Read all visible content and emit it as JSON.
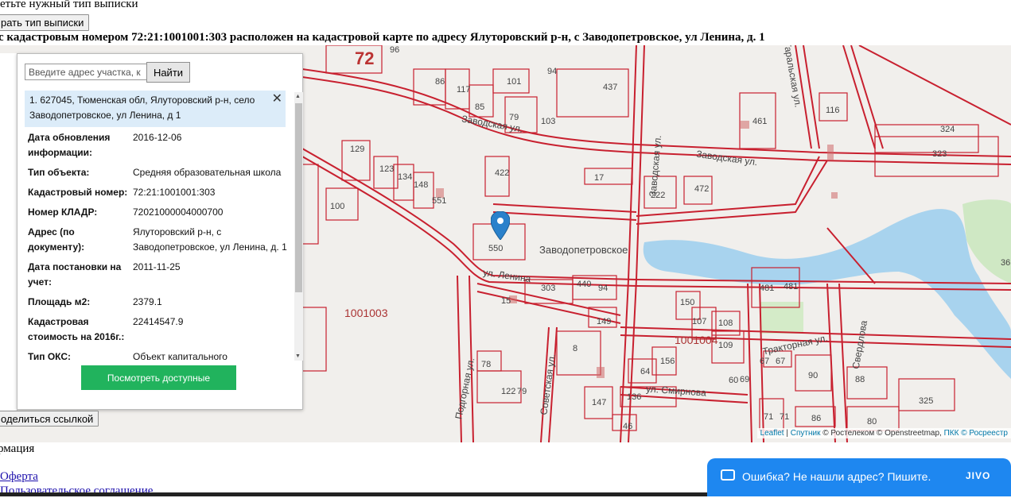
{
  "top": {
    "select_text": "етьте нужный тип выписки",
    "type_button": "рать тип выписки",
    "heading": "с кадастровым номером 72:21:1001001:303 расположен на кадастровой карте по адресу Ялуторовский р-н, с Заводопетровское, ул Ленина, д. 1"
  },
  "panel": {
    "search_placeholder": "Введите адрес участка, к",
    "find_button": "Найти",
    "result_text": "1. 627045, Тюменская обл, Ялуторовский р-н, село Заводопетровское, ул Ленина, д 1",
    "close_glyph": "✕",
    "rows": [
      {
        "k": "Дата обновления информации:",
        "v": "2016-12-06"
      },
      {
        "k": "Тип объекта:",
        "v": "Средняя образовательная школа"
      },
      {
        "k": "Кадастровый номер:",
        "v": "72:21:1001001:303"
      },
      {
        "k": "Номер КЛАДР:",
        "v": "72021000004000700"
      },
      {
        "k": "Адрес (по документу):",
        "v": "Ялуторовский р-н, с Заводопетровское, ул Ленина, д. 1"
      },
      {
        "k": "Дата постановки на учет:",
        "v": "2011-11-25"
      },
      {
        "k": "Площадь м2:",
        "v": "2379.1"
      },
      {
        "k": "Кадастровая стоимость на 2016г.:",
        "v": "22414547.9"
      },
      {
        "k": "Тип ОКС:",
        "v": "Объект капитального строительства"
      }
    ],
    "docs_button": "Посмотреть доступные документы"
  },
  "share_button": "оделиться ссылкой",
  "map": {
    "labels": [
      "72",
      "96",
      "86",
      "117",
      "85",
      "101",
      "94",
      "79",
      "103",
      "437",
      "116",
      "461",
      "324",
      "323",
      "129",
      "123",
      "134",
      "148",
      "551",
      "422",
      "17",
      "222",
      "472",
      "100",
      "550",
      "303",
      "440",
      "94",
      "481",
      "481",
      "150",
      "107",
      "108",
      "149",
      "8",
      "64",
      "156",
      "109",
      "67",
      "67",
      "90",
      "88",
      "325",
      "122",
      "79",
      "78",
      "147",
      "136",
      "46",
      "71",
      "71",
      "86",
      "80",
      "15",
      "69",
      "60",
      "36"
    ],
    "streets": [
      "Заводская ул.",
      "Заводская ул.",
      "Заводопетровское",
      "ул. Ленина",
      "Тракторная ул.",
      "ул. Смирнова",
      "Свердлова",
      "Советская ул.",
      "Подгорная ул.",
      "Заводская ул.",
      "Гаральская ул."
    ],
    "quarters": [
      "1001003",
      "1001004"
    ],
    "attribution": {
      "leaflet": "Leaflet",
      "sep": " | ",
      "sputnik": "Спутник",
      "rest": " © Ростелеком © Openstreetmap, ",
      "pkk": "ПКК © Росреестр"
    }
  },
  "footer": {
    "info": "рмация",
    "offer": "Оферта",
    "agreement": "Пользовательское соглашение"
  },
  "jivo": {
    "text": "Ошибка? Не нашли адрес? Пишите.",
    "logo": "JIVO"
  }
}
